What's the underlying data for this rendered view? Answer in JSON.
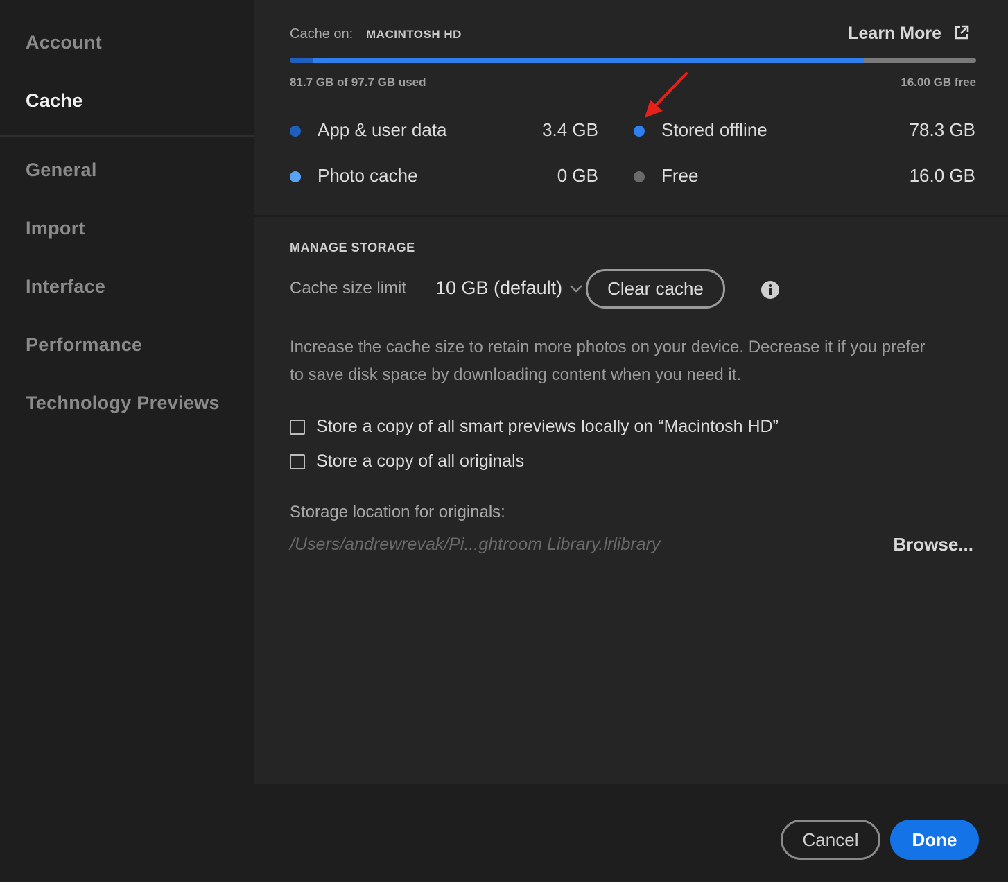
{
  "sidebar": {
    "items": [
      {
        "label": "Account"
      },
      {
        "label": "Cache"
      },
      {
        "label": "General"
      },
      {
        "label": "Import"
      },
      {
        "label": "Interface"
      },
      {
        "label": "Performance"
      },
      {
        "label": "Technology Previews"
      }
    ],
    "active": "Cache"
  },
  "storage": {
    "cache_on_label": "Cache on:",
    "drive_name": "MACINTOSH HD",
    "learn_more": "Learn More",
    "used_text": "81.7 GB of 97.7 GB used",
    "free_text": "16.00 GB free",
    "usage_fractions": {
      "app_user_data": 0.034,
      "photo_cache": 0.0,
      "stored_offline": 0.802,
      "free": 0.164
    },
    "legend": [
      {
        "label": "App & user data",
        "value": "3.4 GB",
        "color": "#1f5fbf"
      },
      {
        "label": "Photo cache",
        "value": "0 GB",
        "color": "#5aa2f5"
      },
      {
        "label": "Stored offline",
        "value": "78.3 GB",
        "color": "#2f80ed"
      },
      {
        "label": "Free",
        "value": "16.0 GB",
        "color": "#6a6a6a"
      }
    ]
  },
  "manage": {
    "title": "MANAGE STORAGE",
    "cache_size_label": "Cache size limit",
    "cache_size_value": "10 GB (default)",
    "clear_cache": "Clear cache",
    "description": "Increase the cache size to retain more photos on your device. Decrease it if you prefer to save disk space by downloading content when you need it.",
    "checkbox_smart_previews": "Store a copy of all smart previews locally on “Macintosh HD”",
    "checkbox_originals": "Store a copy of all originals",
    "location_label": "Storage location for originals:",
    "location_path": "/Users/andrewrevak/Pi...ghtroom Library.lrlibrary",
    "browse": "Browse..."
  },
  "footer": {
    "cancel": "Cancel",
    "done": "Done"
  },
  "colors": {
    "accent": "#1473e6",
    "annotation_arrow": "#e8201a"
  }
}
